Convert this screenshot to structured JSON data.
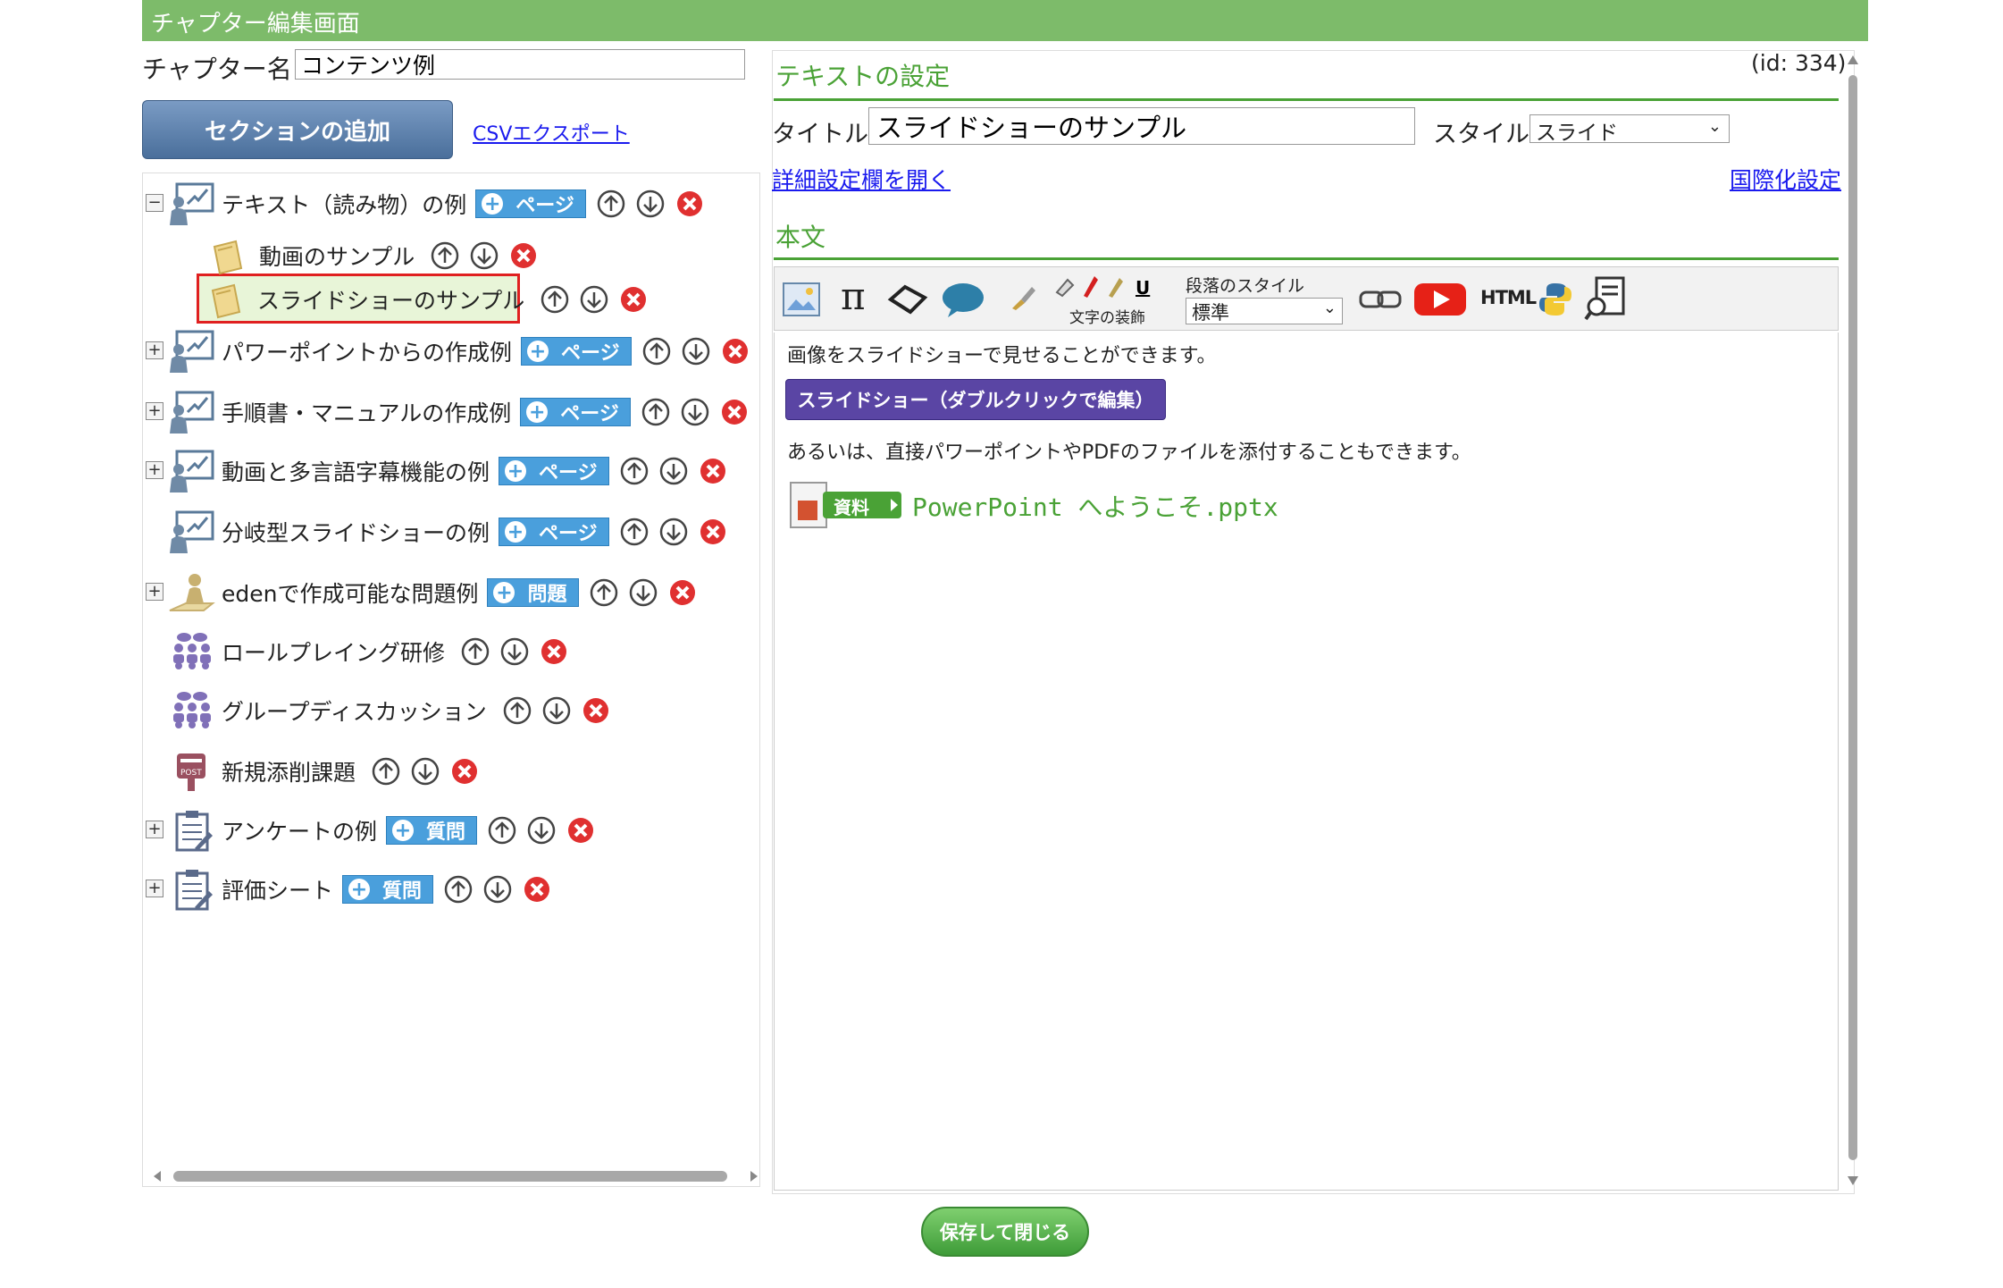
{
  "window_title": "チャプター編集画面",
  "chapter": {
    "label": "チャプター名：",
    "value": "コンテンツ例"
  },
  "add_section_label": "セクションの追加",
  "csv_export_label": "CSVエクスポート",
  "tree": [
    {
      "label": "テキスト（読み物）の例",
      "button": "ページ",
      "expander": "minus",
      "icon": "teacher-icon"
    },
    {
      "label": "動画のサンプル",
      "button": null,
      "expander": null,
      "icon": "page-icon"
    },
    {
      "label": "スライドショーのサンプル",
      "button": null,
      "expander": null,
      "icon": "page-icon",
      "selected": true
    },
    {
      "label": "パワーポイントからの作成例",
      "button": "ページ",
      "expander": "plus",
      "icon": "teacher-icon"
    },
    {
      "label": "手順書・マニュアルの作成例",
      "button": "ページ",
      "expander": "plus",
      "icon": "teacher-icon"
    },
    {
      "label": "動画と多言語字幕機能の例",
      "button": "ページ",
      "expander": "plus",
      "icon": "teacher-icon"
    },
    {
      "label": "分岐型スライドショーの例",
      "button": "ページ",
      "expander": null,
      "icon": "teacher-icon"
    },
    {
      "label": "edenで作成可能な問題例",
      "button": "問題",
      "expander": "plus",
      "icon": "student-icon"
    },
    {
      "label": "ロールプレイング研修",
      "button": null,
      "expander": null,
      "icon": "group-icon"
    },
    {
      "label": "グループディスカッション",
      "button": null,
      "expander": null,
      "icon": "group-icon"
    },
    {
      "label": "新規添削課題",
      "button": null,
      "expander": null,
      "icon": "postbox-icon"
    },
    {
      "label": "アンケートの例",
      "button": "質問",
      "expander": "plus",
      "icon": "clipboard-icon"
    },
    {
      "label": "評価シート",
      "button": "質問",
      "expander": "plus",
      "icon": "clipboard-icon"
    }
  ],
  "editor": {
    "id_label": "(id: 334)",
    "section_heading": "テキストの設定",
    "title_label": "タイトル:",
    "title_value": "スライドショーのサンプル",
    "style_label": "スタイル:",
    "style_value": "スライド",
    "detail_link": "詳細設定欄を開く",
    "intl_link": "国際化設定",
    "body_heading": "本文",
    "toolbar": {
      "decoration_label": "文字の装飾",
      "paragraph_style_label": "段落のスタイル",
      "paragraph_style_value": "標準",
      "html_label": "HTML"
    },
    "content": {
      "para1": "画像をスライドショーで見せることができます。",
      "slideshow_button": "スライドショー（ダブルクリックで編集）",
      "para2": "あるいは、直接パワーポイントやPDFのファイルを添付することもできます。",
      "attachment_badge": "資料",
      "attachment_name": "PowerPoint へようこそ.pptx"
    }
  },
  "save_button": "保存して閉じる",
  "colors": {
    "header_green": "#7dbb6a",
    "accent_green": "#4aa236",
    "link_blue": "#1a1aee",
    "page_button": "#4a9fdc",
    "slideshow_purple": "#5a45a4",
    "selected_border": "#e02020"
  }
}
